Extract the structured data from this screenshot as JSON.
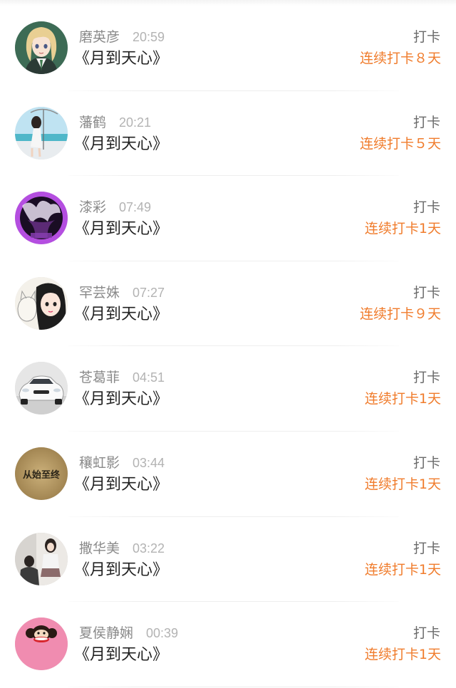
{
  "checkins": [
    {
      "name": "磨英彦",
      "time": "20:59",
      "book": "《月到天心》",
      "type": "打卡",
      "streak": "连续打卡８天",
      "avatar": "anime-girl-avatar"
    },
    {
      "name": "藩鹤",
      "time": "20:21",
      "book": "《月到天心》",
      "type": "打卡",
      "streak": "连续打卡５天",
      "avatar": "beach-girl-avatar"
    },
    {
      "name": "漆彩",
      "time": "07:49",
      "book": "《月到天心》",
      "type": "打卡",
      "streak": "连续打卡1天",
      "avatar": "purple-art-avatar"
    },
    {
      "name": "罕芸姝",
      "time": "07:27",
      "book": "《月到天心》",
      "type": "打卡",
      "streak": "连续打卡９天",
      "avatar": "cartoon-girl-cat-avatar"
    },
    {
      "name": "苍葛菲",
      "time": "04:51",
      "book": "《月到天心》",
      "type": "打卡",
      "streak": "连续打卡1天",
      "avatar": "white-car-avatar"
    },
    {
      "name": "穰虹影",
      "time": "03:44",
      "book": "《月到天心》",
      "type": "打卡",
      "streak": "连续打卡1天",
      "avatar": "text-avatar",
      "avatar_text": "从始至终"
    },
    {
      "name": "撒华美",
      "time": "03:22",
      "book": "《月到天心》",
      "type": "打卡",
      "streak": "连续打卡1天",
      "avatar": "couple-photo-avatar"
    },
    {
      "name": "夏侯静娴",
      "time": "00:39",
      "book": "《月到天心》",
      "type": "打卡",
      "streak": "连续打卡1天",
      "avatar": "monkey-avatar"
    }
  ],
  "colors": {
    "accent": "#f07c2c",
    "name": "#8a8a8a",
    "time": "#b3b3b3",
    "book": "#222222",
    "type": "#6a6a6a"
  }
}
